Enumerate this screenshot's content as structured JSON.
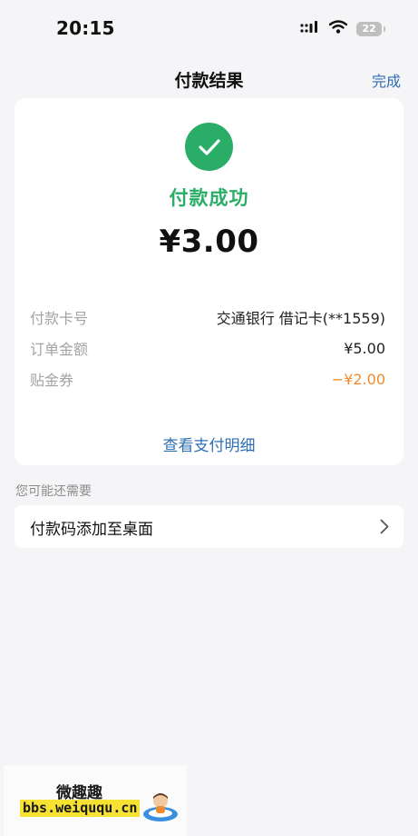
{
  "status_bar": {
    "time": "20:15",
    "battery": "22"
  },
  "nav": {
    "title": "付款结果",
    "done_label": "完成"
  },
  "result": {
    "status_text": "付款成功",
    "amount": "¥3.00",
    "details": [
      {
        "label": "付款卡号",
        "value": "交通银行 借记卡(**1559)"
      },
      {
        "label": "订单金额",
        "value": "¥5.00"
      },
      {
        "label": "贴金券",
        "value": "−¥2.00"
      }
    ],
    "view_detail_label": "查看支付明细"
  },
  "suggestions": {
    "section_title": "您可能还需要",
    "items": [
      {
        "label": "付款码添加至桌面"
      }
    ]
  },
  "watermark": {
    "title": "微趣趣",
    "url": "bbs.weiququ.cn"
  },
  "colors": {
    "success": "#2aae67",
    "link": "#2f6fb7",
    "discount": "#f08a2e",
    "background": "#f5f5f7"
  }
}
